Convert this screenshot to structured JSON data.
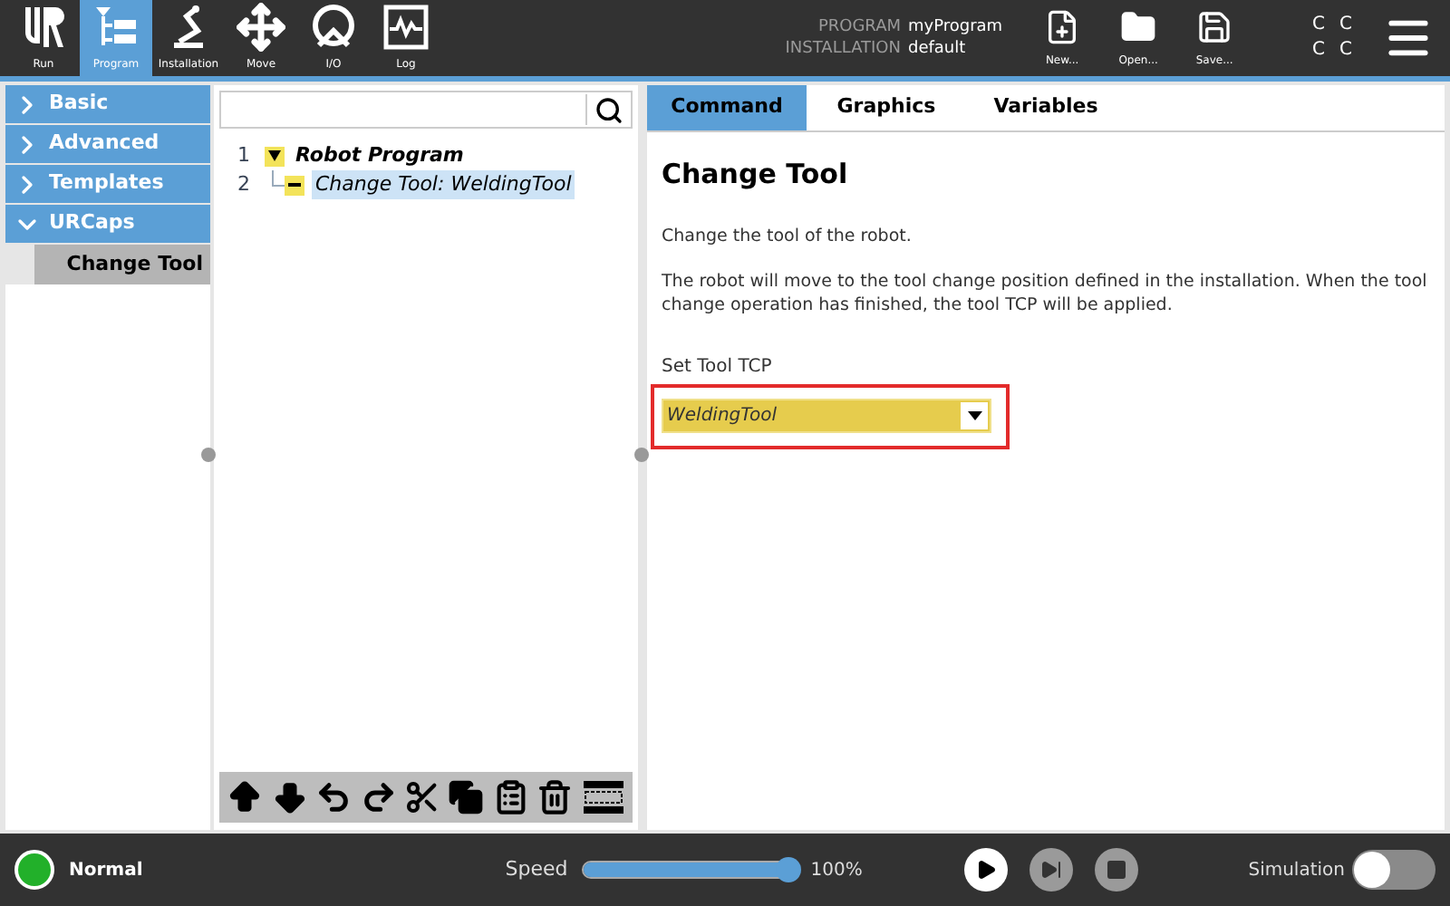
{
  "top_nav": [
    {
      "label": "Run",
      "kind": "logo",
      "selected": false
    },
    {
      "label": "Program",
      "kind": "program",
      "selected": true
    },
    {
      "label": "Installation",
      "kind": "installation",
      "selected": false
    },
    {
      "label": "Move",
      "kind": "move",
      "selected": false
    },
    {
      "label": "I/O",
      "kind": "io",
      "selected": false
    },
    {
      "label": "Log",
      "kind": "log",
      "selected": false
    }
  ],
  "program": {
    "label": "PROGRAM",
    "value": "myProgram"
  },
  "installation": {
    "label": "INSTALLATION",
    "value": "default"
  },
  "file_buttons": [
    {
      "label": "New...",
      "kind": "new"
    },
    {
      "label": "Open...",
      "kind": "open"
    },
    {
      "label": "Save...",
      "kind": "save"
    }
  ],
  "status_letters": [
    "C",
    "C",
    "C",
    "C"
  ],
  "sidebar": {
    "items": [
      {
        "label": "Basic",
        "expanded": false
      },
      {
        "label": "Advanced",
        "expanded": false
      },
      {
        "label": "Templates",
        "expanded": false
      },
      {
        "label": "URCaps",
        "expanded": true,
        "children": [
          {
            "label": "Change Tool",
            "selected": true
          }
        ]
      }
    ]
  },
  "tree": {
    "rows": [
      {
        "number": "1",
        "label": "Robot Program",
        "kind": "root",
        "selected": false,
        "children": [
          {
            "number": "2",
            "label": "Change Tool: WeldingTool",
            "kind": "leaf",
            "selected": true
          }
        ]
      }
    ]
  },
  "tree_toolbar": [
    {
      "kind": "up"
    },
    {
      "kind": "down"
    },
    {
      "kind": "undo"
    },
    {
      "kind": "redo"
    },
    {
      "kind": "cut"
    },
    {
      "kind": "copy"
    },
    {
      "kind": "paste"
    },
    {
      "kind": "delete"
    },
    {
      "kind": "suppress"
    }
  ],
  "tabs": [
    {
      "label": "Command",
      "selected": true
    },
    {
      "label": "Graphics",
      "selected": false
    },
    {
      "label": "Variables",
      "selected": false
    }
  ],
  "command": {
    "title": "Change Tool",
    "paragraphs": [
      "Change the tool of the robot.",
      "The robot will move to the tool change position defined in the installation. When the tool change operation has finished, the tool TCP will be applied."
    ],
    "field_label": "Set Tool TCP",
    "dropdown": {
      "value": "WeldingTool",
      "highlighted": true
    }
  },
  "footer": {
    "status": "Normal",
    "speed_label": "Speed",
    "speed": {
      "level": 1.0
    },
    "speed_reading": "100%",
    "simulation": {
      "label": "Simulation",
      "on": false
    }
  }
}
